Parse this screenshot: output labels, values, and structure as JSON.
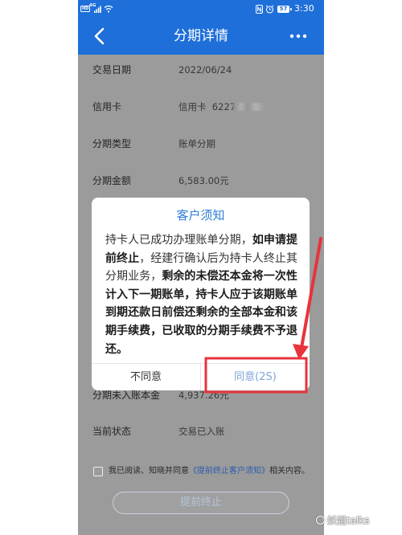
{
  "status_bar": {
    "hd_label": "HD",
    "network_label": "4G",
    "battery_level": "57",
    "time": "3:30",
    "icons": [
      "hd-icon",
      "signal-icon",
      "wifi-icon",
      "nfc-icon",
      "alarm-icon",
      "battery-icon"
    ]
  },
  "header": {
    "title": "分期详情",
    "back_icon": "chevron-left-icon",
    "menu_icon": "more-dots-icon"
  },
  "details": {
    "rows_top": [
      {
        "label": "交易日期",
        "value": "2022/06/24"
      },
      {
        "label": "信用卡",
        "value": "信用卡  6227"
      },
      {
        "label": "分期类型",
        "value": "账单分期"
      },
      {
        "label": "分期金额",
        "value": "6,583.00元"
      }
    ],
    "rows_bottom": [
      {
        "label": "分期未入账本金",
        "value": "4,937.26元"
      },
      {
        "label": "当前状态",
        "value": "交易已入账"
      }
    ]
  },
  "dialog": {
    "title": "客户须知",
    "body": [
      {
        "text": "持卡人已成功办理账单分期，",
        "bold": false
      },
      {
        "text": "如申请提前终止",
        "bold": true
      },
      {
        "text": "，经建行确认后为持卡人终止其分期业务，",
        "bold": false
      },
      {
        "text": "剩余的未偿还本金将一次性计入下一期账单，持卡人应于该期账单到期还款日前偿还剩余的全部本金和该期手续费，已收取的分期手续费不予退还。",
        "bold": true
      }
    ],
    "disagree_label": "不同意",
    "agree_label": "同意(2S)"
  },
  "agreement": {
    "checked": false,
    "prefix": "我已阅读、知晓并同意",
    "link": "《提前终止客户须知》",
    "suffix": "相关内容。"
  },
  "action_button": {
    "label": "提前终止",
    "enabled": false
  },
  "watermark": {
    "text": "妖姐talks",
    "icon": "watermark-logo-icon"
  },
  "colors": {
    "brand": "#1e6fd9",
    "link": "#2a5cae",
    "dialog_title": "#2f7ed8",
    "annotation": "#e8333c",
    "agree_disabled": "#7fa6d6"
  }
}
